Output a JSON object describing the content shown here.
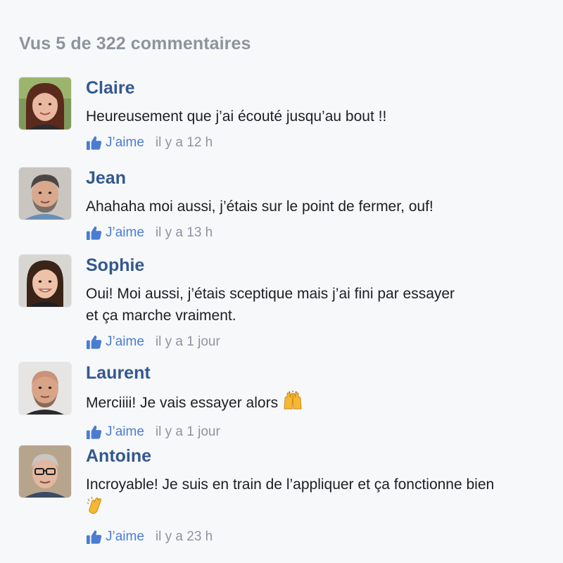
{
  "header": {
    "title": "Vus 5 de 322 commentaires"
  },
  "colors": {
    "name": "#34588f",
    "like": "#4a7dd1",
    "muted": "#8d949e",
    "text": "#1c1e21"
  },
  "comments": [
    {
      "author": "Claire",
      "lines": [
        "Heureusement que j’ai écouté jusqu’au bout !!"
      ],
      "like_label": "J’aime",
      "time": "il y a 12 h"
    },
    {
      "author": "Jean",
      "lines": [
        "Ahahaha moi aussi, j’étais sur le point de fermer, ouf!"
      ],
      "like_label": "J’aime",
      "time": "il y a 13 h"
    },
    {
      "author": "Sophie",
      "lines": [
        "Oui! Moi aussi, j’étais sceptique mais j’ai fini par essayer",
        "et ça marche vraiment."
      ],
      "like_label": "J’aime",
      "time": "il y a 1 jour"
    },
    {
      "author": "Laurent",
      "lines": [
        "Merciiii! Je vais essayer alors"
      ],
      "emoji": "raising-hands-icon",
      "like_label": "J’aime",
      "time": "il y a 1 jour"
    },
    {
      "author": "Antoine",
      "lines": [
        "Incroyable! Je suis en train de l’appliquer et ça fonctionne bien"
      ],
      "emoji": "clapping-hands-icon",
      "like_label": "J’aime",
      "time": "il y a 23 h"
    }
  ]
}
